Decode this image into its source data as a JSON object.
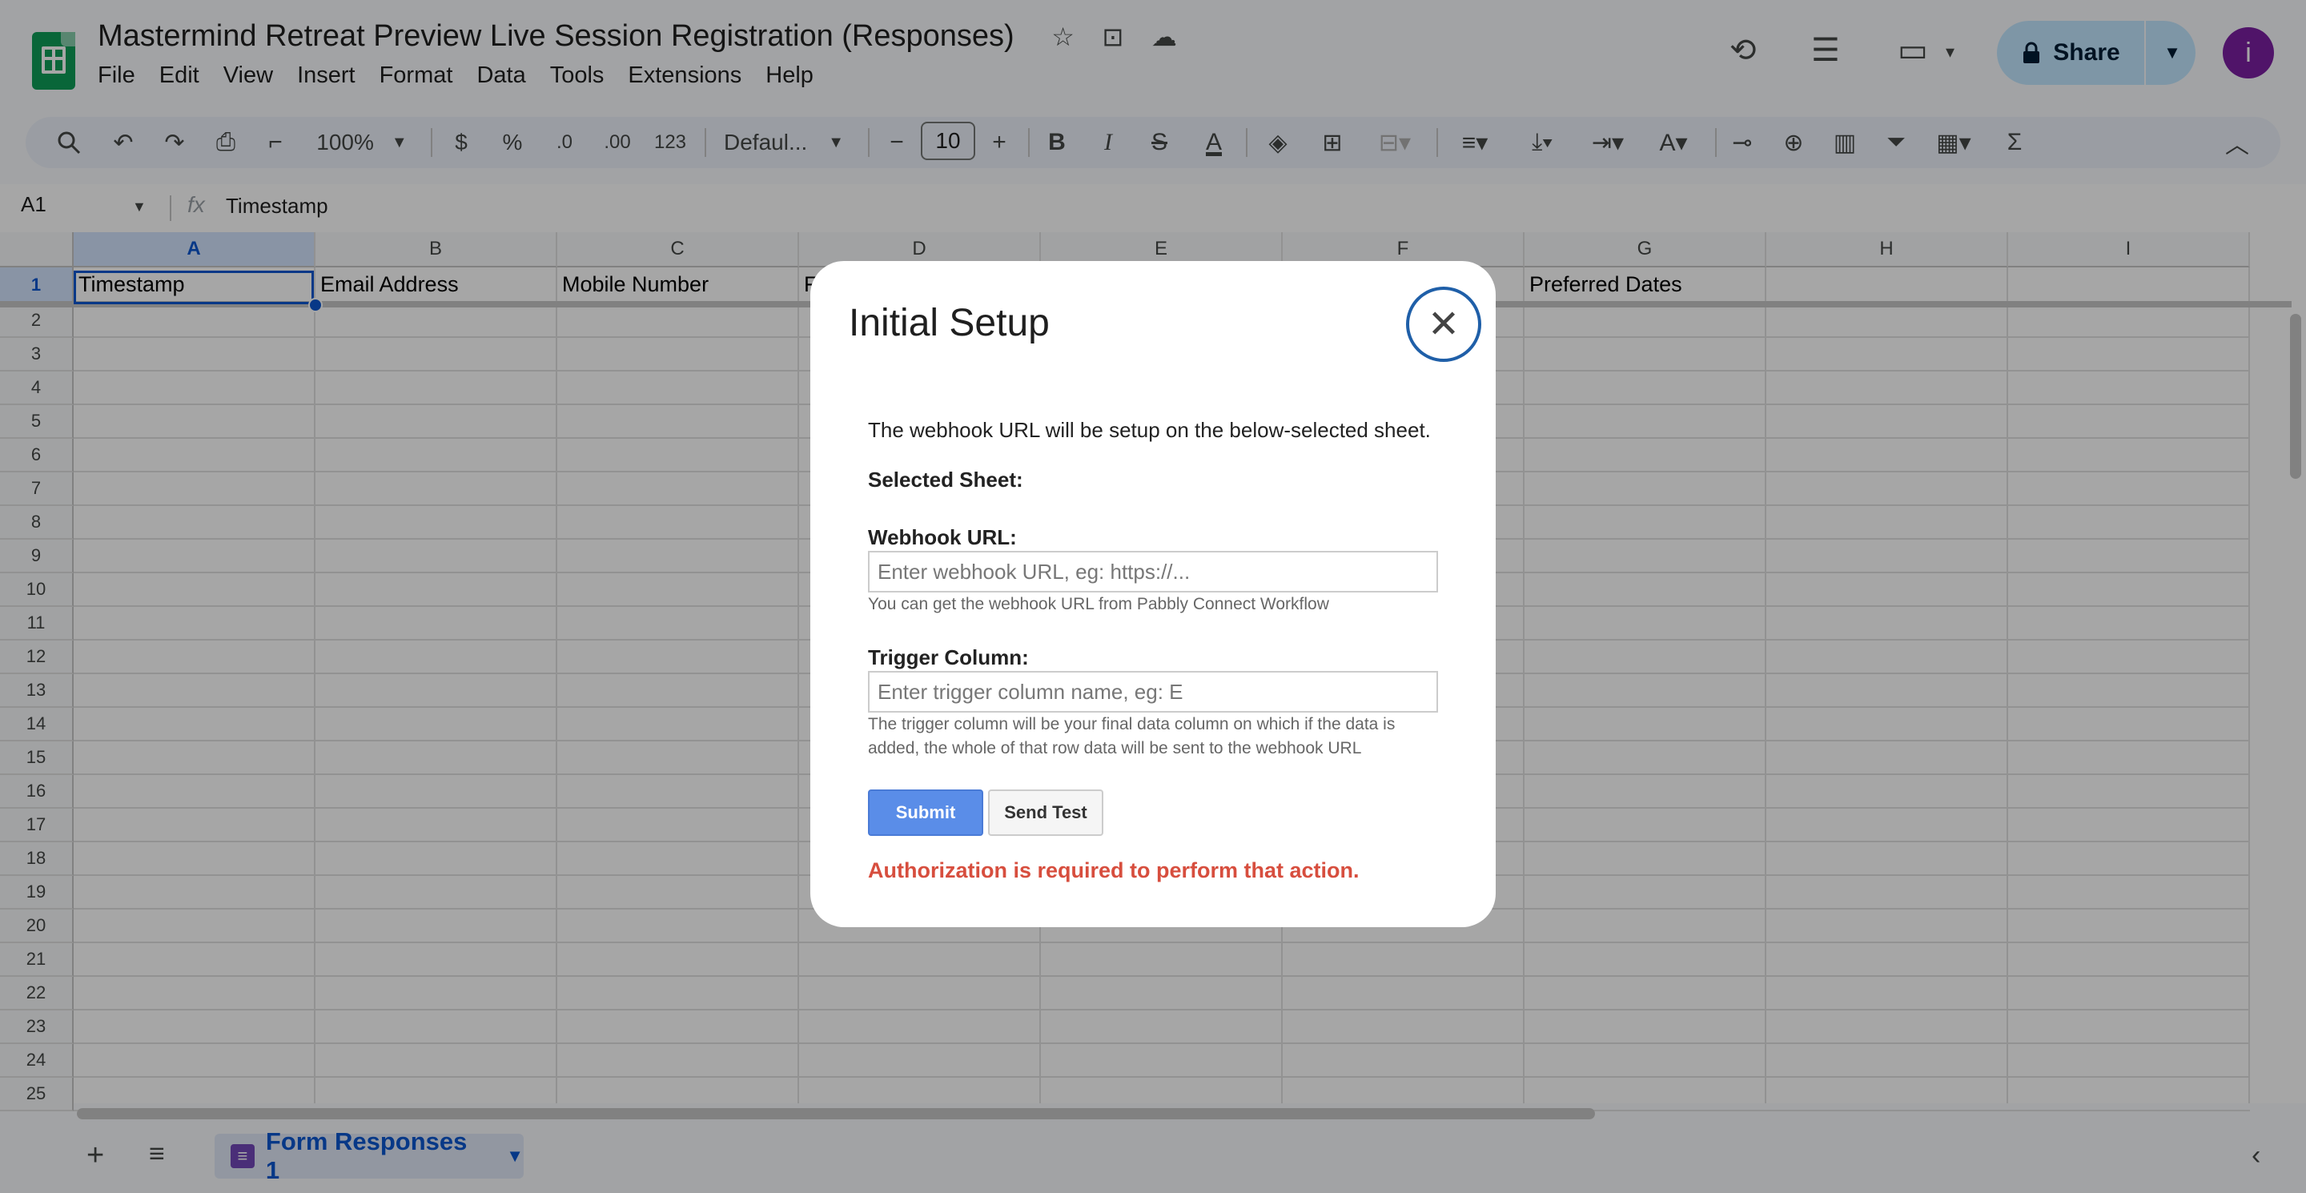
{
  "app": {
    "title": "Mastermind Retreat Preview Live Session Registration (Responses)",
    "menu": [
      "File",
      "Edit",
      "View",
      "Insert",
      "Format",
      "Data",
      "Tools",
      "Extensions",
      "Help"
    ],
    "share_label": "Share",
    "avatar_letter": "i"
  },
  "toolbar": {
    "zoom": "100%",
    "currency": "$",
    "percent": "%",
    "dec_decrease": ".0",
    "dec_increase": ".00",
    "number_format": "123",
    "font": "Defaul...",
    "font_size": "10"
  },
  "formula_bar": {
    "cell_ref": "A1",
    "fx": "fx",
    "content": "Timestamp"
  },
  "grid": {
    "columns": [
      "A",
      "B",
      "C",
      "D",
      "E",
      "F",
      "G",
      "H",
      "I"
    ],
    "rows": [
      "1",
      "2",
      "3",
      "4",
      "5",
      "6",
      "7",
      "8",
      "9",
      "10",
      "11",
      "12",
      "13",
      "14",
      "15",
      "16",
      "17",
      "18",
      "19",
      "20",
      "21",
      "22",
      "23",
      "24",
      "25"
    ],
    "row1": [
      "Timestamp",
      "Email Address",
      "Mobile Number",
      "F",
      "",
      "",
      "Preferred Dates"
    ]
  },
  "sheet_tab": {
    "label": "Form Responses 1"
  },
  "dialog": {
    "title": "Initial Setup",
    "intro": "The webhook URL will be setup on the below-selected sheet.",
    "selected_sheet_label": "Selected Sheet:",
    "webhook_label": "Webhook URL:",
    "webhook_placeholder": "Enter webhook URL, eg: https://...",
    "webhook_help": "You can get the webhook URL from Pabbly Connect Workflow",
    "trigger_label": "Trigger Column:",
    "trigger_placeholder": "Enter trigger column name, eg: E",
    "trigger_help": "The trigger column will be your final data column on which if the data is added, the whole of that row data will be sent to the webhook URL",
    "submit_label": "Submit",
    "send_test_label": "Send Test",
    "error": "Authorization is required to perform that action."
  },
  "colors": {
    "accent": "#0b57d0",
    "submit": "#5a8de8",
    "error": "#d74e3e",
    "logo": "#0f9d58",
    "avatar": "#7b1fa2"
  }
}
